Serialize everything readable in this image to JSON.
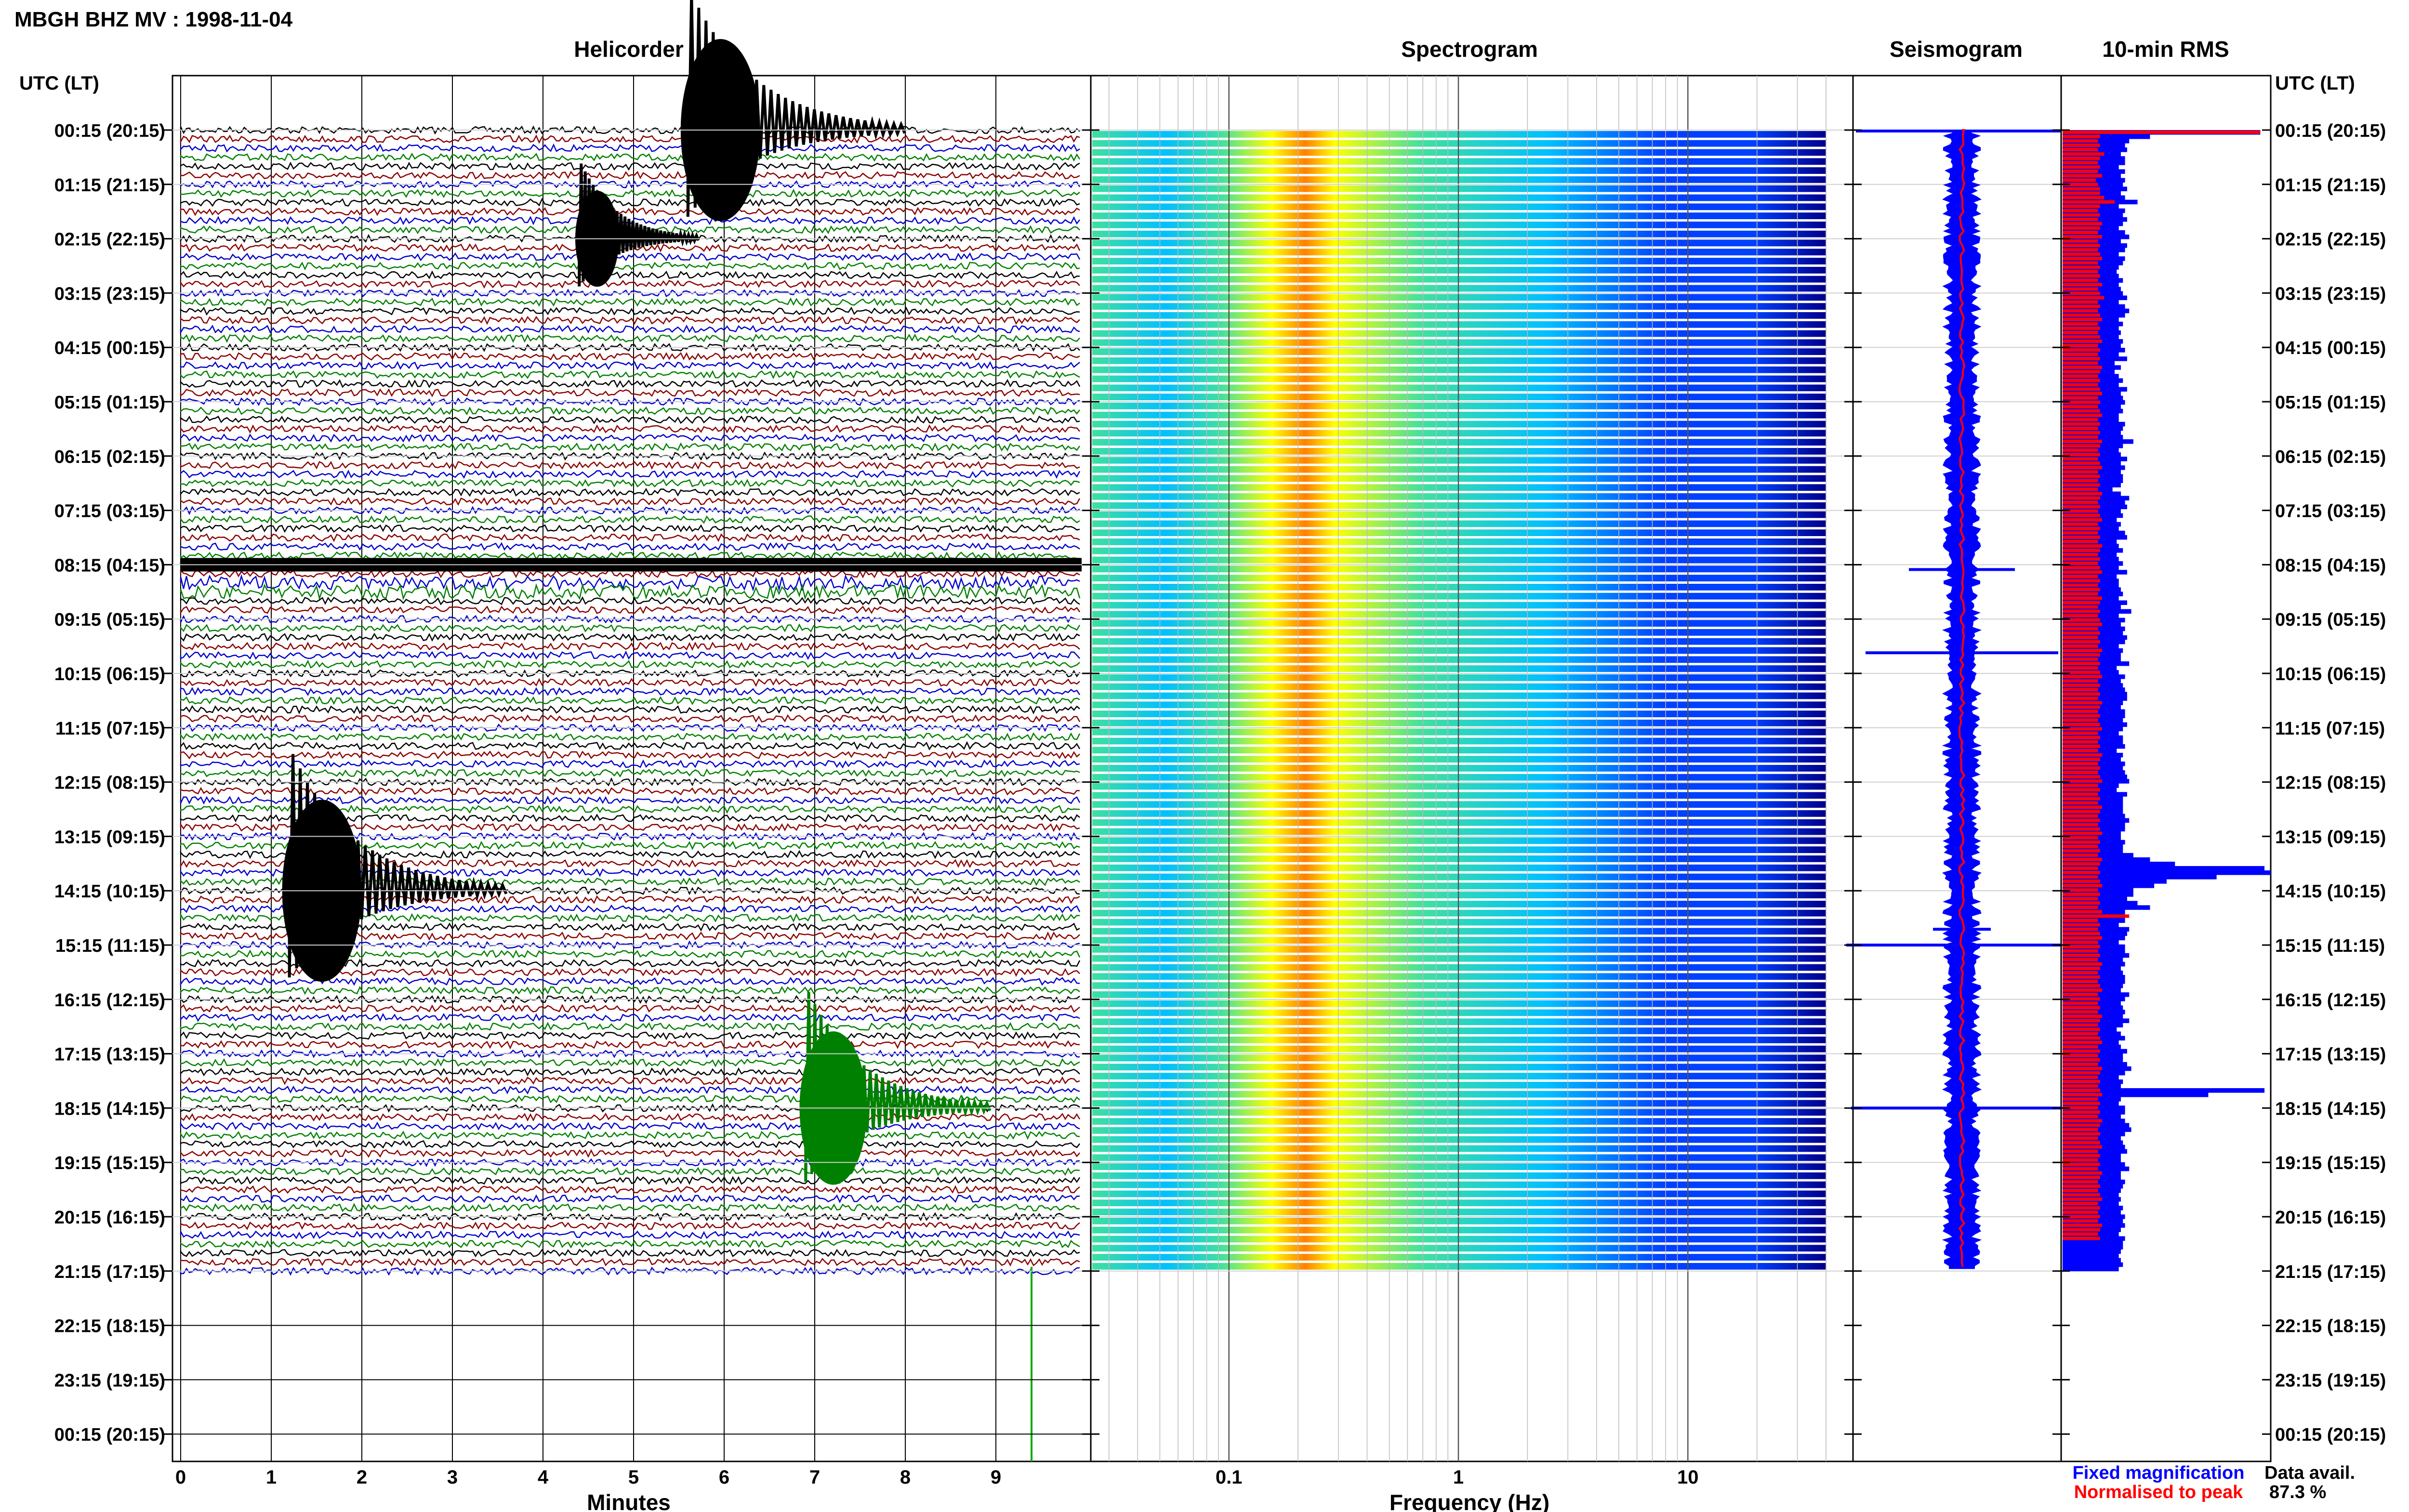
{
  "header": {
    "station_title": "MBGH BHZ MV : 1998-11-04"
  },
  "panels": {
    "helicorder": "Helicorder",
    "spectrogram": "Spectrogram",
    "seismogram": "Seismogram",
    "rms": "10-min RMS"
  },
  "axes": {
    "time_header_left": "UTC (LT)",
    "time_header_right": "UTC (LT)",
    "helicorder_xlabel": "Minutes",
    "spectrogram_xlabel": "Frequency (Hz)"
  },
  "legend": {
    "fixed": "Fixed magnification",
    "normalised": "Normalised to peak",
    "fixed_color": "#0000ff",
    "normalised_color": "#ff0000"
  },
  "availability": {
    "label": "Data avail.",
    "value": "87.3 %"
  },
  "chart_data": [
    {
      "type": "line",
      "panel": "Helicorder",
      "xlabel": "Minutes",
      "xlim": [
        0,
        10
      ],
      "x_ticks": [
        "0",
        "1",
        "2",
        "3",
        "4",
        "5",
        "6",
        "7",
        "8",
        "9"
      ],
      "ylabel": "UTC (LT)",
      "y_ticks": [
        "00:15 (20:15)",
        "01:15 (21:15)",
        "02:15 (22:15)",
        "03:15 (23:15)",
        "04:15 (00:15)",
        "05:15 (01:15)",
        "06:15 (02:15)",
        "07:15 (03:15)",
        "08:15 (04:15)",
        "09:15 (05:15)",
        "10:15 (06:15)",
        "11:15 (07:15)",
        "12:15 (08:15)",
        "13:15 (09:15)",
        "14:15 (10:15)",
        "15:15 (11:15)",
        "16:15 (12:15)",
        "17:15 (13:15)",
        "18:15 (14:15)",
        "19:15 (15:15)",
        "20:15 (16:15)",
        "21:15 (17:15)",
        "22:15 (18:15)",
        "23:15 (19:15)",
        "00:15 (20:15)"
      ],
      "trace_colors": [
        "#000000",
        "#8b0000",
        "#0000cc",
        "#008000"
      ],
      "events": [
        {
          "time": "00:15",
          "minute": 5.6,
          "amplitude": 1.0,
          "color": "#000000"
        },
        {
          "time": "02:15",
          "minute": 4.4,
          "amplitude": 0.25,
          "color": "#000000"
        },
        {
          "time": "08:15",
          "minute": 0.0,
          "amplitude": 0.3,
          "color": "#000000",
          "note": "continuous"
        },
        {
          "time": "14:15",
          "minute": 1.2,
          "amplitude": 1.0,
          "color": "#000000"
        },
        {
          "time": "18:15",
          "minute": 6.9,
          "amplitude": 0.75,
          "color": "#008000"
        }
      ]
    },
    {
      "type": "heatmap",
      "panel": "Spectrogram",
      "xlabel": "Frequency (Hz)",
      "x_scale": "log",
      "xlim": [
        0.025,
        40
      ],
      "x_ticks": [
        "0.1",
        "1",
        "10"
      ],
      "colormap": [
        "#00008b",
        "#0040ff",
        "#00c0ff",
        "#40e0a0",
        "#ffff00",
        "#ff8000",
        "#ff0000"
      ],
      "peak_band_hz": [
        0.17,
        0.35
      ]
    },
    {
      "type": "line",
      "panel": "Seismogram",
      "series": [
        {
          "name": "Fixed magnification",
          "color": "#0000ff"
        },
        {
          "name": "Normalised to peak",
          "color": "#ff0000"
        }
      ]
    },
    {
      "type": "bar",
      "panel": "10-min RMS",
      "orientation": "horizontal",
      "categories_start": "00:15",
      "categories_end": "21:15",
      "blue_values": [
        0.95,
        0.42,
        0.32,
        0.3,
        0.31,
        0.28,
        0.3,
        0.3,
        0.27,
        0.3,
        0.28,
        0.3,
        0.29,
        0.31,
        0.28,
        0.3,
        0.36,
        0.27,
        0.3,
        0.29,
        0.31,
        0.29,
        0.27,
        0.3,
        0.32,
        0.28,
        0.31,
        0.3,
        0.27,
        0.3,
        0.29,
        0.27,
        0.26,
        0.27,
        0.29,
        0.27,
        0.28,
        0.29,
        0.31,
        0.27,
        0.3,
        0.32,
        0.3,
        0.27,
        0.29,
        0.27,
        0.28,
        0.27,
        0.29,
        0.28,
        0.3,
        0.27,
        0.31,
        0.25,
        0.28,
        0.25,
        0.27,
        0.29,
        0.27,
        0.31,
        0.28,
        0.29,
        0.3,
        0.28,
        0.29,
        0.27,
        0.27,
        0.3,
        0.29,
        0.28,
        0.29,
        0.34,
        0.29,
        0.27,
        0.28,
        0.31,
        0.28,
        0.3,
        0.28,
        0.29,
        0.29,
        0.28,
        0.24,
        0.28,
        0.32,
        0.3,
        0.31,
        0.28,
        0.29,
        0.26,
        0.28,
        0.27,
        0.3,
        0.31,
        0.26,
        0.27,
        0.29,
        0.26,
        0.27,
        0.29,
        0.27,
        0.31,
        0.26,
        0.27,
        0.27,
        0.28,
        0.29,
        0.27,
        0.31,
        0.28,
        0.33,
        0.27,
        0.3,
        0.28,
        0.3,
        0.29,
        0.31,
        0.3,
        0.27,
        0.29,
        0.28,
        0.28,
        0.32,
        0.26,
        0.27,
        0.3,
        0.28,
        0.29,
        0.3,
        0.31,
        0.31,
        0.29,
        0.28,
        0.3,
        0.3,
        0.29,
        0.31,
        0.29,
        0.27,
        0.29,
        0.29,
        0.3,
        0.26,
        0.29,
        0.28,
        0.3,
        0.29,
        0.3,
        0.31,
        0.32,
        0.27,
        0.26,
        0.31,
        0.29,
        0.29,
        0.29,
        0.29,
        0.3,
        0.32,
        0.3,
        0.3,
        0.28,
        0.28,
        0.3,
        0.29,
        0.29,
        0.34,
        0.42,
        0.54,
        0.97,
        1.0,
        0.74,
        0.5,
        0.44,
        0.34,
        0.34,
        0.31,
        0.36,
        0.42,
        0.3,
        0.3,
        0.3,
        0.27,
        0.32,
        0.31,
        0.3,
        0.27,
        0.3,
        0.3,
        0.32,
        0.29,
        0.3,
        0.28,
        0.29,
        0.3,
        0.3,
        0.29,
        0.28,
        0.32,
        0.3,
        0.28,
        0.29,
        0.3,
        0.29,
        0.32,
        0.29,
        0.26,
        0.28,
        0.3,
        0.27,
        0.28,
        0.31,
        0.29,
        0.29,
        0.31,
        0.33,
        0.3,
        0.27,
        0.29,
        0.28,
        0.97,
        0.7,
        0.28,
        0.27,
        0.3,
        0.3,
        0.28,
        0.3,
        0.32,
        0.33,
        0.3,
        0.28,
        0.29,
        0.3,
        0.31,
        0.28,
        0.28,
        0.3,
        0.32,
        0.28,
        0.28,
        0.3,
        0.29,
        0.28,
        0.27,
        0.28,
        0.27,
        0.29,
        0.28,
        0.3,
        0.29,
        0.3,
        0.28,
        0.27,
        0.3,
        0.29,
        0.29,
        0.28,
        0.27,
        0.28,
        0.29,
        0.27
      ],
      "red_values": [
        0.95,
        0.18,
        0.17,
        0.18,
        0.17,
        0.2,
        0.18,
        0.17,
        0.18,
        0.17,
        0.19,
        0.16,
        0.17,
        0.18,
        0.18,
        0.2,
        0.25,
        0.18,
        0.17,
        0.18,
        0.17,
        0.19,
        0.18,
        0.17,
        0.19,
        0.17,
        0.18,
        0.17,
        0.18,
        0.19,
        0.17,
        0.18,
        0.17,
        0.18,
        0.17,
        0.19,
        0.17,
        0.18,
        0.2,
        0.17,
        0.18,
        0.17,
        0.18,
        0.19,
        0.17,
        0.18,
        0.17,
        0.18,
        0.19,
        0.17,
        0.18,
        0.17,
        0.18,
        0.17,
        0.19,
        0.18,
        0.17,
        0.18,
        0.17,
        0.18,
        0.19,
        0.17,
        0.18,
        0.17,
        0.18,
        0.19,
        0.17,
        0.18,
        0.17,
        0.18,
        0.17,
        0.19,
        0.18,
        0.17,
        0.18,
        0.17,
        0.18,
        0.19,
        0.17,
        0.18,
        0.17,
        0.18,
        0.17,
        0.19,
        0.18,
        0.17,
        0.18,
        0.17,
        0.18,
        0.19,
        0.17,
        0.18,
        0.17,
        0.18,
        0.17,
        0.19,
        0.18,
        0.17,
        0.18,
        0.17,
        0.18,
        0.19,
        0.17,
        0.18,
        0.17,
        0.18,
        0.17,
        0.19,
        0.18,
        0.17,
        0.18,
        0.17,
        0.18,
        0.19,
        0.17,
        0.18,
        0.17,
        0.18,
        0.17,
        0.19,
        0.18,
        0.17,
        0.18,
        0.17,
        0.18,
        0.19,
        0.17,
        0.18,
        0.17,
        0.18,
        0.17,
        0.19,
        0.18,
        0.17,
        0.18,
        0.17,
        0.18,
        0.19,
        0.17,
        0.18,
        0.17,
        0.18,
        0.17,
        0.19,
        0.18,
        0.17,
        0.18,
        0.17,
        0.18,
        0.19,
        0.17,
        0.18,
        0.17,
        0.18,
        0.17,
        0.19,
        0.18,
        0.17,
        0.18,
        0.17,
        0.18,
        0.19,
        0.17,
        0.18,
        0.17,
        0.18,
        0.17,
        0.19,
        0.18,
        0.17,
        0.18,
        0.17,
        0.18,
        0.19,
        0.17,
        0.18,
        0.17,
        0.18,
        0.17,
        0.19,
        0.32,
        0.17,
        0.18,
        0.17,
        0.18,
        0.19,
        0.17,
        0.18,
        0.17,
        0.18,
        0.17,
        0.19,
        0.18,
        0.17,
        0.18,
        0.17,
        0.18,
        0.19,
        0.17,
        0.18,
        0.17,
        0.18,
        0.17,
        0.19,
        0.18,
        0.17,
        0.18,
        0.17,
        0.18,
        0.19,
        0.17,
        0.18,
        0.17,
        0.18,
        0.17,
        0.19,
        0.18,
        0.17,
        0.18,
        0.17,
        0.18,
        0.19,
        0.17,
        0.18,
        0.17,
        0.18,
        0.17,
        0.19,
        0.18,
        0.17,
        0.18,
        0.17,
        0.18,
        0.19,
        0.17,
        0.18,
        0.17,
        0.18,
        0.17,
        0.19,
        0.18,
        0.17,
        0.18,
        0.17,
        0.18,
        0.19,
        0.17,
        0.18,
        0.17,
        0.18,
        0.17,
        0.19,
        0.18,
        0.17,
        0.18
      ]
    }
  ]
}
